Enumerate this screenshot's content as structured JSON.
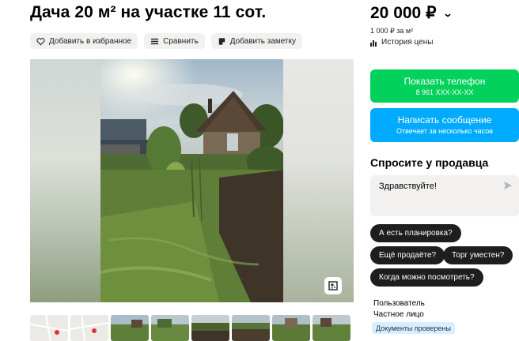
{
  "listing": {
    "title": "Дача 20 м² на участке 11 сот."
  },
  "actions": {
    "favorite": "Добавить в избранное",
    "compare": "Сравнить",
    "note": "Добавить заметку"
  },
  "price": {
    "value": "20 000 ₽",
    "per_meter": "1 000 ₽ за м²",
    "history": "История цены"
  },
  "contact": {
    "phone_label": "Показать телефон",
    "phone_number": "8 961 XXX-XX-XX",
    "message_label": "Написать сообщение",
    "message_sub": "Отвечает за несколько часов"
  },
  "ask": {
    "title": "Спросите у продавца",
    "message": "Здравствуйте!",
    "chips": [
      "А есть планировка?",
      "Ещё продаёте?",
      "Торг уместен?",
      "Когда можно посмотреть?"
    ]
  },
  "seller": {
    "name": "Пользователь",
    "type": "Частное лицо",
    "badge": "Документы проверены"
  },
  "icons": {
    "favorite": "heart-icon",
    "compare": "compare-icon",
    "note": "note-icon",
    "history": "chart-icon",
    "send": "send-icon",
    "expand": "expand-icon",
    "price_menu": "chevron-down-icon"
  },
  "colors": {
    "green": "#02d15c",
    "blue": "#00aaff",
    "chip": "#1e1e1e",
    "badge": "#d7f0ff"
  }
}
